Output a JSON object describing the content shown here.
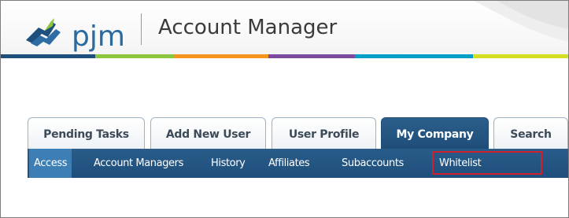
{
  "header": {
    "logo_text": "pjm",
    "app_title": "Account Manager",
    "colorbar": [
      "#1f4f7c",
      "#8cc63f",
      "#f7941d",
      "#7c4a9e",
      "#00a0c6",
      "#d7df23"
    ]
  },
  "tabs": [
    {
      "label": "Pending Tasks",
      "active": false
    },
    {
      "label": "Add New User",
      "active": false
    },
    {
      "label": "User Profile",
      "active": false
    },
    {
      "label": "My Company",
      "active": true
    },
    {
      "label": "Search",
      "active": false
    }
  ],
  "subnav": [
    {
      "label": "Access",
      "active": true
    },
    {
      "label": "Account Managers",
      "active": false
    },
    {
      "label": "History",
      "active": false
    },
    {
      "label": "Affiliates",
      "active": false
    },
    {
      "label": "Subaccounts",
      "active": false
    },
    {
      "label": "Whitelist",
      "active": false,
      "highlighted": true
    }
  ],
  "colors": {
    "nav_blue": "#1f4f7c",
    "active_sub": "#3d7fb5",
    "highlight_red": "#d0202e"
  }
}
